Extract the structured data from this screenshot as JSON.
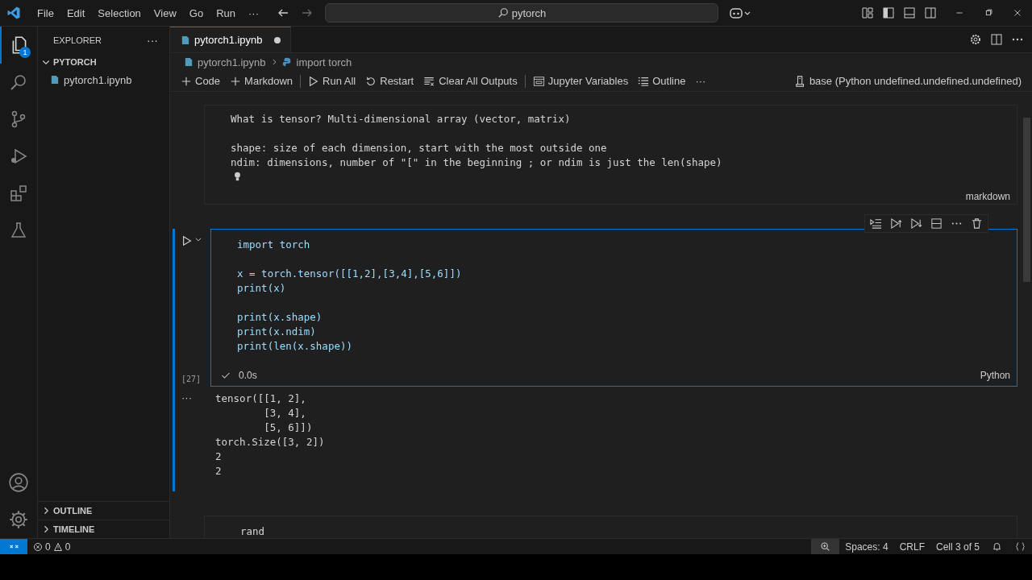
{
  "title_bar": {
    "menu": [
      "File",
      "Edit",
      "Selection",
      "View",
      "Go",
      "Run",
      "···"
    ],
    "search": "pytorch"
  },
  "activity_bar": {
    "badge": "1"
  },
  "sidebar": {
    "title": "EXPLORER",
    "more": "···",
    "folder": {
      "label": "PYTORCH",
      "expanded": true,
      "files": [
        "pytorch1.ipynb"
      ]
    },
    "sections": [
      {
        "label": "OUTLINE",
        "expanded": false
      },
      {
        "label": "TIMELINE",
        "expanded": false
      }
    ]
  },
  "tabs": [
    {
      "label": "pytorch1.ipynb",
      "selected": true,
      "modified": true
    }
  ],
  "breadcrumb": [
    "pytorch1.ipynb",
    "import torch"
  ],
  "toolbar": {
    "items": [
      {
        "kind": "plus",
        "label": "Code"
      },
      {
        "kind": "plus",
        "label": "Markdown"
      },
      {
        "kind": "run",
        "label": "Run All"
      },
      {
        "kind": "restart",
        "label": "Restart"
      },
      {
        "kind": "clear",
        "label": "Clear All Outputs"
      },
      {
        "kind": "variables",
        "label": "Jupyter Variables"
      },
      {
        "kind": "outline",
        "label": "Outline"
      }
    ],
    "more": "···",
    "kernel": "base (Python undefined.undefined.undefined)"
  },
  "markdown_cell": {
    "blocks": [
      [
        "What is tensor? Multi-dimensional array (vector, matrix)"
      ],
      [
        "shape: size of each dimension, start with the most outside one",
        "ndim: dimensions, number of \"[\" in the beginning ; or ndim is just the len(shape)"
      ]
    ],
    "language": "markdown"
  },
  "code_cell": {
    "blocks": [
      [
        "import torch"
      ],
      [
        "x = torch.tensor([[1,2],[3,4],[5,6]])",
        "print(x)"
      ],
      [
        "print(x.shape)",
        "print(x.ndim)",
        "print(len(x.shape))"
      ]
    ],
    "execution_count": "[27]",
    "succeeded": true,
    "duration": "0.0s",
    "language": "Python",
    "output_more": "···",
    "output": [
      "tensor([[1, 2],",
      "        [3, 4],",
      "        [5, 6]])",
      "torch.Size([3, 2])",
      "2",
      "2"
    ]
  },
  "next_cell": {
    "lines": [
      "rand"
    ]
  },
  "status_bar": {
    "errors": "0",
    "warnings": "0",
    "items": [
      "Spaces: 4",
      "CRLF",
      "Cell 3 of 5"
    ]
  }
}
